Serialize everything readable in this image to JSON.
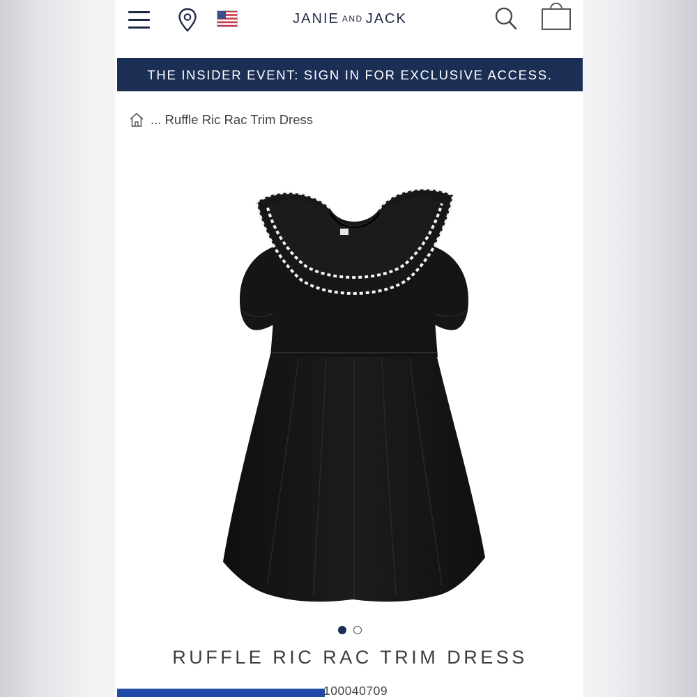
{
  "header": {
    "logo_main_left": "JANIE",
    "logo_small": "AND",
    "logo_main_right": "JACK",
    "icons": [
      "menu-icon",
      "location-pin-icon",
      "us-flag-icon",
      "search-icon",
      "shopping-bag-icon"
    ]
  },
  "promo": {
    "text": "THE INSIDER EVENT: SIGN IN FOR EXCLUSIVE ACCESS."
  },
  "breadcrumb": {
    "home_icon": "home-icon",
    "text": "... Ruffle Ric Rac Trim Dress"
  },
  "product": {
    "title": "RUFFLE RIC RAC TRIM DRESS",
    "item_number": "100040709",
    "image_count": 2,
    "active_image": 1
  },
  "colors": {
    "navy": "#1b2f55",
    "dress": "#161616",
    "trim": "#f4f4f4",
    "item_bar_blue": "#1f4aa8"
  }
}
